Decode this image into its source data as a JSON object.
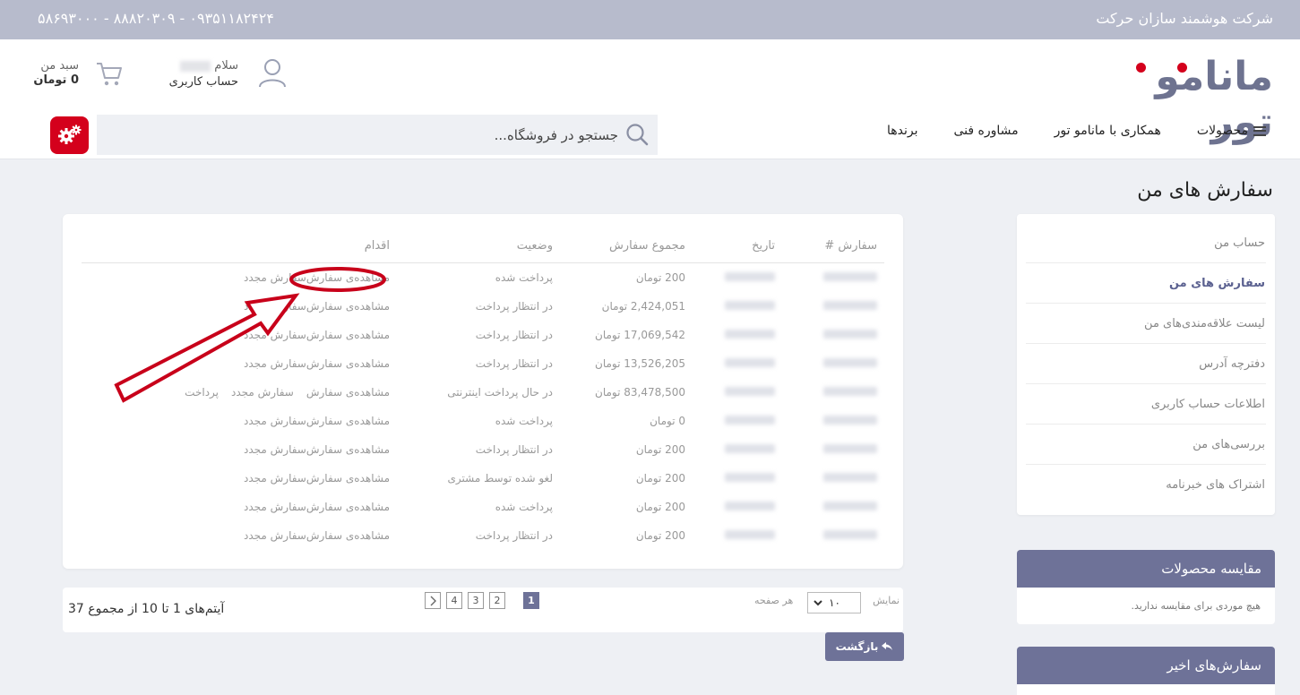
{
  "topbar": {
    "company": "شرکت هوشمند سازان حرکت",
    "phones": "۵۸۶۹۳۰۰۰ - ۸۸۸۲۰۳۰۹ - ۰۹۳۵۱۱۸۲۴۲۴"
  },
  "header": {
    "logo_text": "مانامو تور",
    "greeting": "سلام",
    "account_label": "حساب کاربری",
    "cart_label": "سبد من",
    "cart_total": "0 تومان"
  },
  "nav": {
    "items": [
      {
        "label": "محصولات"
      },
      {
        "label": "همکاری با مانامو تور"
      },
      {
        "label": "مشاوره فنی"
      },
      {
        "label": "برندها"
      }
    ]
  },
  "search": {
    "placeholder": "جستجو در فروشگاه..."
  },
  "page_title": "سفارش های من",
  "sidebar": {
    "items": [
      {
        "label": "حساب من"
      },
      {
        "label": "سفارش های من"
      },
      {
        "label": "لیست علاقه‌مندی‌های من"
      },
      {
        "label": "دفترچه آدرس"
      },
      {
        "label": "اطلاعات حساب کاربری"
      },
      {
        "label": "بررسی‌های من"
      },
      {
        "label": "اشتراک های خبرنامه"
      }
    ]
  },
  "compare_panel": {
    "title": "مقایسه محصولات",
    "body": "هیچ موردی برای مقایسه ندارید."
  },
  "recent_panel": {
    "title": "سفارش‌های اخیر"
  },
  "table": {
    "headers": {
      "order": "سفارش #",
      "date": "تاریخ",
      "total": "مجموع سفارش",
      "status": "وضعیت",
      "action": "اقدام"
    },
    "view_label": "مشاهده‌ی سفارش",
    "reorder_label": "سفارش مجدد",
    "pay_label": "پرداخت",
    "rows": [
      {
        "total": "200 تومان",
        "status": "پرداخت شده"
      },
      {
        "total": "2,424,051 تومان",
        "status": "در انتظار پرداخت"
      },
      {
        "total": "17,069,542 تومان",
        "status": "در انتظار پرداخت"
      },
      {
        "total": "13,526,205 تومان",
        "status": "در انتظار پرداخت"
      },
      {
        "total": "83,478,500 تومان",
        "status": "در حال پرداخت اینترنتی"
      },
      {
        "total": "0 تومان",
        "status": "پرداخت شده"
      },
      {
        "total": "200 تومان",
        "status": "در انتظار پرداخت"
      },
      {
        "total": "200 تومان",
        "status": "لغو شده توسط مشتری"
      },
      {
        "total": "200 تومان",
        "status": "پرداخت شده"
      },
      {
        "total": "200 تومان",
        "status": "در انتظار پرداخت"
      }
    ]
  },
  "pager": {
    "summary": "آیتم‌های 1 تا 10 از مجموع 37",
    "pages": [
      "1",
      "2",
      "3",
      "4"
    ],
    "show_label": "نمایش",
    "per_page_value": "۱۰",
    "per_page_label": "هر صفحه"
  },
  "back_button": "بازگشت"
}
